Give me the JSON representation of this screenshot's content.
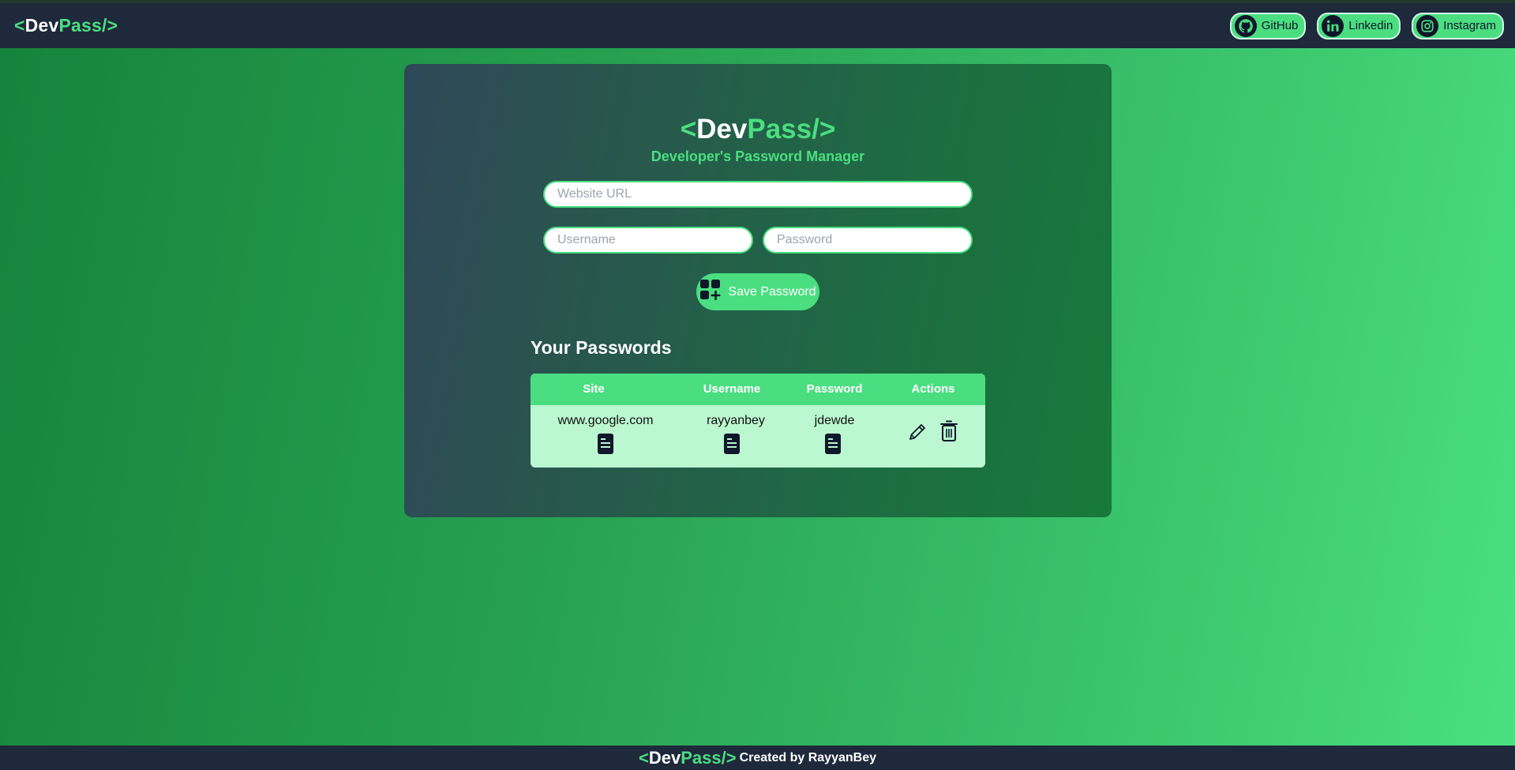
{
  "navbar": {
    "logo": {
      "open": "<",
      "dev": "Dev",
      "pass": "Pass/",
      "close": ">"
    },
    "links": [
      {
        "label": "GitHub",
        "icon": "github-icon"
      },
      {
        "label": "Linkedin",
        "icon": "linkedin-icon"
      },
      {
        "label": "Instagram",
        "icon": "instagram-icon"
      }
    ]
  },
  "main": {
    "title": {
      "open": "<",
      "dev": "Dev",
      "pass": "Pass/",
      "close": ">"
    },
    "subtitle": "Developer's Password Manager",
    "form": {
      "site_placeholder": "Website URL",
      "username_placeholder": "Username",
      "password_placeholder": "Password",
      "save_label": "Save Password"
    },
    "passwords_heading": "Your Passwords",
    "table": {
      "headers": [
        "Site",
        "Username",
        "Password",
        "Actions"
      ],
      "rows": [
        {
          "site": "www.google.com",
          "username": "rayyanbey",
          "password": "jdewde"
        }
      ]
    }
  },
  "footer": {
    "logo": {
      "open": "<",
      "dev": "Dev",
      "pass": "Pass/",
      "close": ">"
    },
    "credit": "Created by RayyanBey"
  },
  "colors": {
    "accent": "#4ade80",
    "nav_bg": "#1e293b",
    "row_bg": "#bbf7d0"
  }
}
